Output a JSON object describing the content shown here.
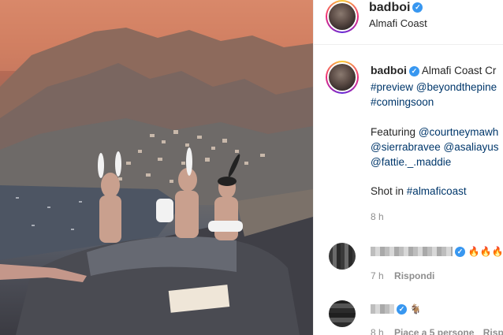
{
  "post": {
    "username": "badboi",
    "location": "Almafi Coast"
  },
  "caption": {
    "username": "badboi",
    "line1_rest": "Almafi Coast Cr",
    "line2_a": "#preview",
    "line2_b": "@beyondthepine",
    "line3": "#comingsoon",
    "featuring_label": "Featuring",
    "featuring_1": "@courtneymawh",
    "line5_a": "@sierrabravee",
    "line5_b": "@asaliayus",
    "line6": "@fattie._.maddie",
    "shot_label": "Shot in",
    "shot_tag": "#almaficoast",
    "time": "8 h"
  },
  "comments": [
    {
      "emojis": "🔥🔥🔥",
      "time": "7 h",
      "reply_label": "Rispondi"
    },
    {
      "emojis": "🐐",
      "time": "8 h",
      "likes_label": "Piace a 5 persone",
      "reply_label": "Risp"
    }
  ],
  "icons": {
    "verified": "verified-badge-icon",
    "avatar": "profile-avatar-icon"
  },
  "colors": {
    "verified_blue": "#3897f0",
    "link_blue": "#00376b",
    "meta_gray": "#8e8e8e"
  }
}
